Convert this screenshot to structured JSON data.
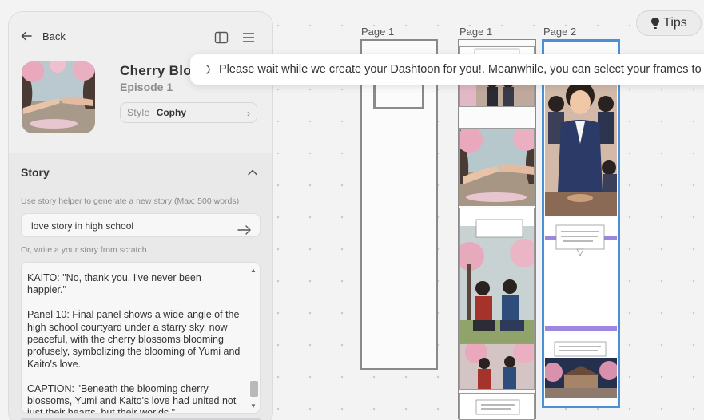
{
  "header": {
    "back_label": "Back",
    "tips_label": "Tips"
  },
  "project": {
    "title": "Cherry Blos",
    "episode": "Episode 1",
    "style_label": "Style",
    "style_value": "Cophy"
  },
  "story": {
    "heading": "Story",
    "helper_text": "Use story helper to generate a new story (Max: 500 words)",
    "prompt_value": "love story in high school",
    "or_write_text": "Or, write a your story from scratch",
    "paragraphs": [
      "KAITO: \"No, thank you. I've never been happier.\"",
      "Panel 10: Final panel shows a wide-angle of the high school courtyard under a starry sky, now peaceful, with the cherry blossoms blooming profusely, symbolizing the blooming of Yumi and Kaito's love.",
      "CAPTION: \"Beneath the blooming cherry blossoms, Yumi and Kaito's love had united not just their hearts, but their worlds.\""
    ]
  },
  "toast": {
    "message": "Please wait while we create your Dashtoon for you!. Meanwhile, you can select your frames to vi"
  },
  "pages": [
    {
      "label": "Page 1"
    },
    {
      "label": "Page 1"
    },
    {
      "label": "Page 2"
    }
  ],
  "icons": {
    "back": "arrow-left-icon",
    "panel_toggle": "sidebar-panel-icon",
    "menu": "hamburger-menu-icon",
    "style_chevron": "chevron-right-icon",
    "story_toggle": "chevron-up-icon",
    "send": "arrow-right-icon",
    "spinner": "loading-spinner-icon",
    "tips": "lightbulb-icon"
  },
  "colors": {
    "selected_page_border": "#4b8fd6",
    "panel_bg": "#e9e9ea",
    "purple_divider": "#9c86e0"
  }
}
